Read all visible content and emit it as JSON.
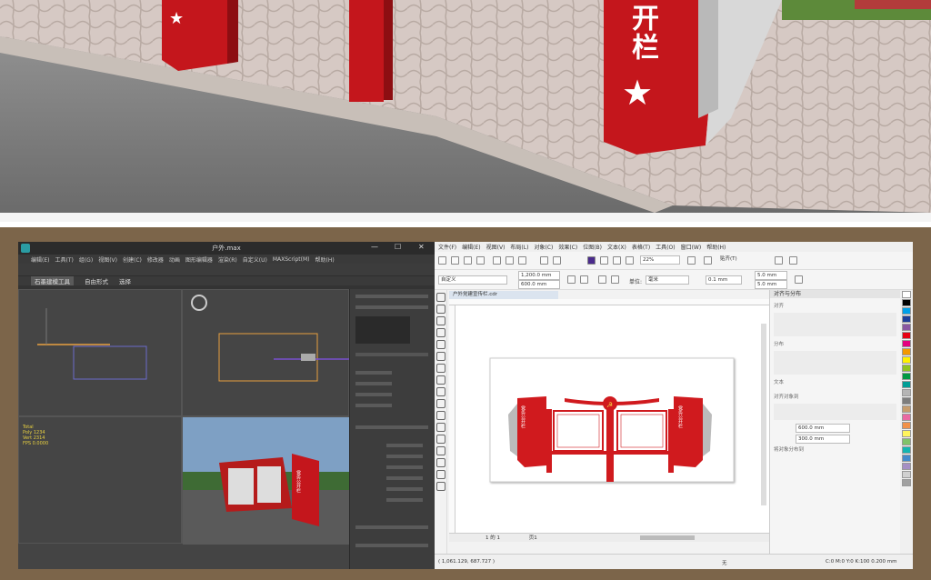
{
  "scene": {
    "post_text": "开栏",
    "star": "★",
    "small_star": "★"
  },
  "max": {
    "title": "户外.max",
    "window_controls": [
      "—",
      "☐",
      "✕"
    ],
    "menu": [
      "编辑(E)",
      "工具(T)",
      "组(G)",
      "视图(V)",
      "创建(C)",
      "修改器",
      "动画",
      "图形编辑器",
      "渲染(R)",
      "自定义(U)",
      "MAXScript(M)",
      "帮助(H)"
    ],
    "ribbon_tabs": [
      "石墨建模工具",
      "自由形式",
      "选择"
    ],
    "viewport_stats": [
      "Total",
      "Poly 1234",
      "Vert 2314",
      "FPS 0.0000"
    ],
    "viewport_sign_text": "党务公开栏"
  },
  "corel": {
    "menu": [
      "文件(F)",
      "编辑(E)",
      "视图(V)",
      "布局(L)",
      "对象(C)",
      "效果(C)",
      "位图(B)",
      "文本(X)",
      "表格(T)",
      "工具(O)",
      "窗口(W)",
      "帮助(H)"
    ],
    "preset": "自定义",
    "width": "1,200.0 mm",
    "height": "600.0 mm",
    "zoom": "22%",
    "snap": "贴齐(T)",
    "units_label": "单位:",
    "units": "毫米",
    "nudge": "0.1 mm",
    "dup_x": "5.0 mm",
    "dup_y": "5.0 mm",
    "doc_tab": "户外党建宣传栏.cdr",
    "sign_text": "党务公开栏",
    "page_nav": "1 的 1",
    "page_label": "页1",
    "docker_title": "对齐与分布",
    "docker_sections": [
      "对齐",
      "分布",
      "文本",
      "对齐对象到",
      "将对象分布到"
    ],
    "pos_x": "600.0 mm",
    "pos_y": "300.0 mm",
    "status_coords": "( 1,061.129, 687.727 )",
    "status_fill": "无",
    "status_color": "C:0 M:0 Y:0 K:100  0.200 mm",
    "palette": [
      "#ffffff",
      "#000000",
      "#00a0e9",
      "#1f3f99",
      "#8957a1",
      "#e60012",
      "#e4007f",
      "#f39800",
      "#fff100",
      "#8fc31f",
      "#009944",
      "#009e96",
      "#b5b5b5",
      "#7d7d7d",
      "#c69c6d",
      "#ea68a2",
      "#f19149",
      "#fff45c",
      "#80c269",
      "#13b5b1",
      "#448aca",
      "#a58fc4",
      "#d0d0d0",
      "#a0a0a0"
    ]
  }
}
